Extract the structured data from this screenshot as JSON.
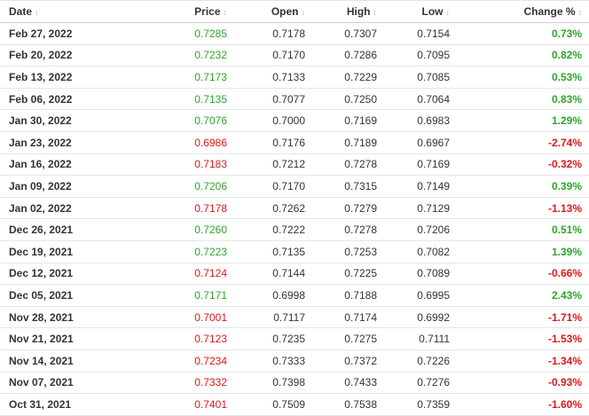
{
  "table": {
    "columns": [
      {
        "label": "Date",
        "sort_icon": "sort-icon"
      },
      {
        "label": "Price",
        "sort_icon": "sort-icon"
      },
      {
        "label": "Open",
        "sort_icon": "sort-icon"
      },
      {
        "label": "High",
        "sort_icon": "sort-icon"
      },
      {
        "label": "Low",
        "sort_icon": "sort-icon"
      },
      {
        "label": "Change %",
        "sort_icon": "sort-icon"
      }
    ],
    "sort_glyph": "↕",
    "colors": {
      "up": "#2fa52a",
      "down": "#e0171a",
      "text": "#333333"
    },
    "rows": [
      {
        "date": "Feb 27, 2022",
        "price": "0.7285",
        "open": "0.7178",
        "high": "0.7307",
        "low": "0.7154",
        "change": "0.73%",
        "dir": "up"
      },
      {
        "date": "Feb 20, 2022",
        "price": "0.7232",
        "open": "0.7170",
        "high": "0.7286",
        "low": "0.7095",
        "change": "0.82%",
        "dir": "up"
      },
      {
        "date": "Feb 13, 2022",
        "price": "0.7173",
        "open": "0.7133",
        "high": "0.7229",
        "low": "0.7085",
        "change": "0.53%",
        "dir": "up"
      },
      {
        "date": "Feb 06, 2022",
        "price": "0.7135",
        "open": "0.7077",
        "high": "0.7250",
        "low": "0.7064",
        "change": "0.83%",
        "dir": "up"
      },
      {
        "date": "Jan 30, 2022",
        "price": "0.7076",
        "open": "0.7000",
        "high": "0.7169",
        "low": "0.6983",
        "change": "1.29%",
        "dir": "up"
      },
      {
        "date": "Jan 23, 2022",
        "price": "0.6986",
        "open": "0.7176",
        "high": "0.7189",
        "low": "0.6967",
        "change": "-2.74%",
        "dir": "down"
      },
      {
        "date": "Jan 16, 2022",
        "price": "0.7183",
        "open": "0.7212",
        "high": "0.7278",
        "low": "0.7169",
        "change": "-0.32%",
        "dir": "down"
      },
      {
        "date": "Jan 09, 2022",
        "price": "0.7206",
        "open": "0.7170",
        "high": "0.7315",
        "low": "0.7149",
        "change": "0.39%",
        "dir": "up"
      },
      {
        "date": "Jan 02, 2022",
        "price": "0.7178",
        "open": "0.7262",
        "high": "0.7279",
        "low": "0.7129",
        "change": "-1.13%",
        "dir": "down"
      },
      {
        "date": "Dec 26, 2021",
        "price": "0.7260",
        "open": "0.7222",
        "high": "0.7278",
        "low": "0.7206",
        "change": "0.51%",
        "dir": "up"
      },
      {
        "date": "Dec 19, 2021",
        "price": "0.7223",
        "open": "0.7135",
        "high": "0.7253",
        "low": "0.7082",
        "change": "1.39%",
        "dir": "up"
      },
      {
        "date": "Dec 12, 2021",
        "price": "0.7124",
        "open": "0.7144",
        "high": "0.7225",
        "low": "0.7089",
        "change": "-0.66%",
        "dir": "down"
      },
      {
        "date": "Dec 05, 2021",
        "price": "0.7171",
        "open": "0.6998",
        "high": "0.7188",
        "low": "0.6995",
        "change": "2.43%",
        "dir": "up"
      },
      {
        "date": "Nov 28, 2021",
        "price": "0.7001",
        "open": "0.7117",
        "high": "0.7174",
        "low": "0.6992",
        "change": "-1.71%",
        "dir": "down"
      },
      {
        "date": "Nov 21, 2021",
        "price": "0.7123",
        "open": "0.7235",
        "high": "0.7275",
        "low": "0.7111",
        "change": "-1.53%",
        "dir": "down"
      },
      {
        "date": "Nov 14, 2021",
        "price": "0.7234",
        "open": "0.7333",
        "high": "0.7372",
        "low": "0.7226",
        "change": "-1.34%",
        "dir": "down"
      },
      {
        "date": "Nov 07, 2021",
        "price": "0.7332",
        "open": "0.7398",
        "high": "0.7433",
        "low": "0.7276",
        "change": "-0.93%",
        "dir": "down"
      },
      {
        "date": "Oct 31, 2021",
        "price": "0.7401",
        "open": "0.7509",
        "high": "0.7538",
        "low": "0.7359",
        "change": "-1.60%",
        "dir": "down"
      }
    ]
  }
}
